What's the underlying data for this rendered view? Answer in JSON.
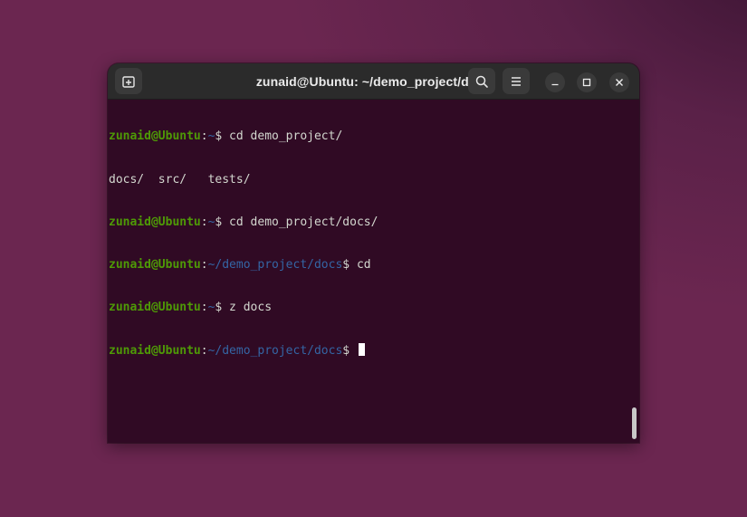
{
  "window": {
    "title": "zunaid@Ubuntu: ~/demo_project/docs"
  },
  "toolbar": {
    "new_tab_icon": "new-tab-icon",
    "search_icon": "search-icon",
    "menu_icon": "hamburger-menu-icon",
    "minimize_icon": "minimize-icon",
    "maximize_icon": "maximize-icon",
    "close_icon": "close-icon"
  },
  "terminal": {
    "lines": [
      {
        "user": "zunaid@Ubuntu",
        "sep": ":",
        "path": "~",
        "sigil": "$",
        "cmd": " cd demo_project/"
      },
      {
        "output": "docs/  src/   tests/"
      },
      {
        "user": "zunaid@Ubuntu",
        "sep": ":",
        "path": "~",
        "sigil": "$",
        "cmd": " cd demo_project/docs/"
      },
      {
        "user": "zunaid@Ubuntu",
        "sep": ":",
        "path": "~/demo_project/docs",
        "sigil": "$",
        "cmd": " cd"
      },
      {
        "user": "zunaid@Ubuntu",
        "sep": ":",
        "path": "~",
        "sigil": "$",
        "cmd": " z docs"
      },
      {
        "user": "zunaid@Ubuntu",
        "sep": ":",
        "path": "~/demo_project/docs",
        "sigil": "$",
        "cmd": " "
      }
    ]
  },
  "colors": {
    "terminal_bg": "#300a24",
    "user_host": "#4e9a06",
    "path": "#3465a4",
    "text": "#d3d7cf",
    "headerbar": "#2b2b2b",
    "desktop": "#6b2650"
  }
}
